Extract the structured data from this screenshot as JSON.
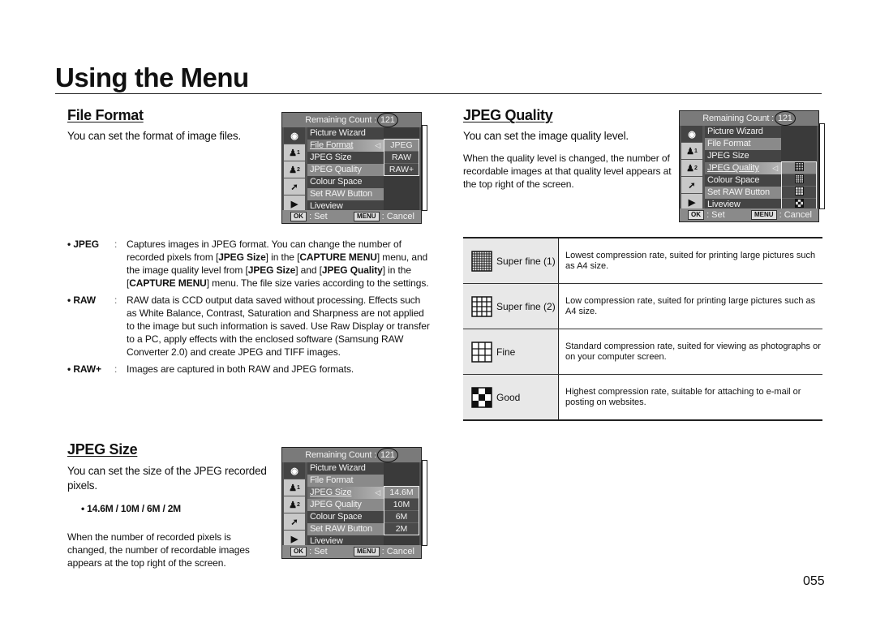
{
  "page": {
    "title": "Using the Menu",
    "page_number": "055"
  },
  "file_format": {
    "heading": "File Format",
    "lead": "You can set the format of image files.",
    "items": [
      {
        "term": "• JPEG",
        "sep": ":",
        "parts": [
          {
            "t": "Captures images in JPEG format. You can change the number of recorded pixels from ["
          },
          {
            "t": "JPEG Size",
            "b": true
          },
          {
            "t": "] in the ["
          },
          {
            "t": "CAPTURE MENU",
            "b": true
          },
          {
            "t": "] menu, and the image quality level from ["
          },
          {
            "t": "JPEG Size",
            "b": true
          },
          {
            "t": "] and ["
          },
          {
            "t": "JPEG Quality",
            "b": true
          },
          {
            "t": "] in the ["
          },
          {
            "t": "CAPTURE MENU",
            "b": true
          },
          {
            "t": "] menu. The file size varies according to the settings."
          }
        ]
      },
      {
        "term": "• RAW",
        "sep": ":",
        "parts": [
          {
            "t": "RAW data is CCD output data saved without processing. Effects such as White Balance, Contrast, Saturation and Sharpness are not applied to the image but such information is saved. Use Raw Display or transfer to a PC, apply effects with the enclosed software (Samsung RAW Converter 2.0) and create JPEG and TIFF images."
          }
        ]
      },
      {
        "term": "• RAW+",
        "sep": ":",
        "parts": [
          {
            "t": "Images are captured in both RAW and JPEG formats."
          }
        ]
      }
    ]
  },
  "jpeg_quality": {
    "heading": "JPEG Quality",
    "lead": "You can set the image quality level.",
    "note": "When the quality level is changed, the number of recordable images at that quality level appears at the top right of the screen.",
    "table": [
      {
        "icon": "super-fine-1-icon",
        "label": "Super fine (1)",
        "desc": "Lowest compression rate, suited for printing large pictures such as A4 size."
      },
      {
        "icon": "super-fine-2-icon",
        "label": "Super fine (2)",
        "desc": "Low compression rate, suited for printing large pictures such as A4 size."
      },
      {
        "icon": "fine-icon",
        "label": "Fine",
        "desc": "Standard compression rate, suited for viewing as photographs or on your computer screen."
      },
      {
        "icon": "good-icon",
        "label": "Good",
        "desc": "Highest compression rate, suitable for attaching to e-mail or posting on websites."
      }
    ]
  },
  "jpeg_size": {
    "heading": "JPEG Size",
    "lead": "You can set the size of the JPEG recorded pixels.",
    "options": "•  14.6M / 10M / 6M / 2M",
    "note": "When the number of recorded pixels is changed, the number of recordable images appears at the top right of the screen."
  },
  "lcd": {
    "remaining_label": "Remaining Count :",
    "remaining_count": "121",
    "side_icons": [
      "camera-icon",
      "custom-1-icon",
      "custom-2-icon",
      "setup-wrench-icon",
      "playback-icon"
    ],
    "menu_items": [
      "Picture Wizard",
      "File Format",
      "JPEG Size",
      "JPEG Quality",
      "Colour Space",
      "Set RAW Button",
      "Liveview"
    ],
    "ok_key": "OK",
    "ok_label": ": Set",
    "menu_key": "MENU",
    "menu_label": ": Cancel",
    "file_format_options": [
      "JPEG",
      "RAW",
      "RAW+"
    ],
    "jpeg_size_options": [
      "14.6M",
      "10M",
      "6M",
      "2M"
    ],
    "jpeg_quality_options": [
      "super-fine-1-icon",
      "super-fine-2-icon",
      "fine-icon",
      "good-icon"
    ]
  }
}
